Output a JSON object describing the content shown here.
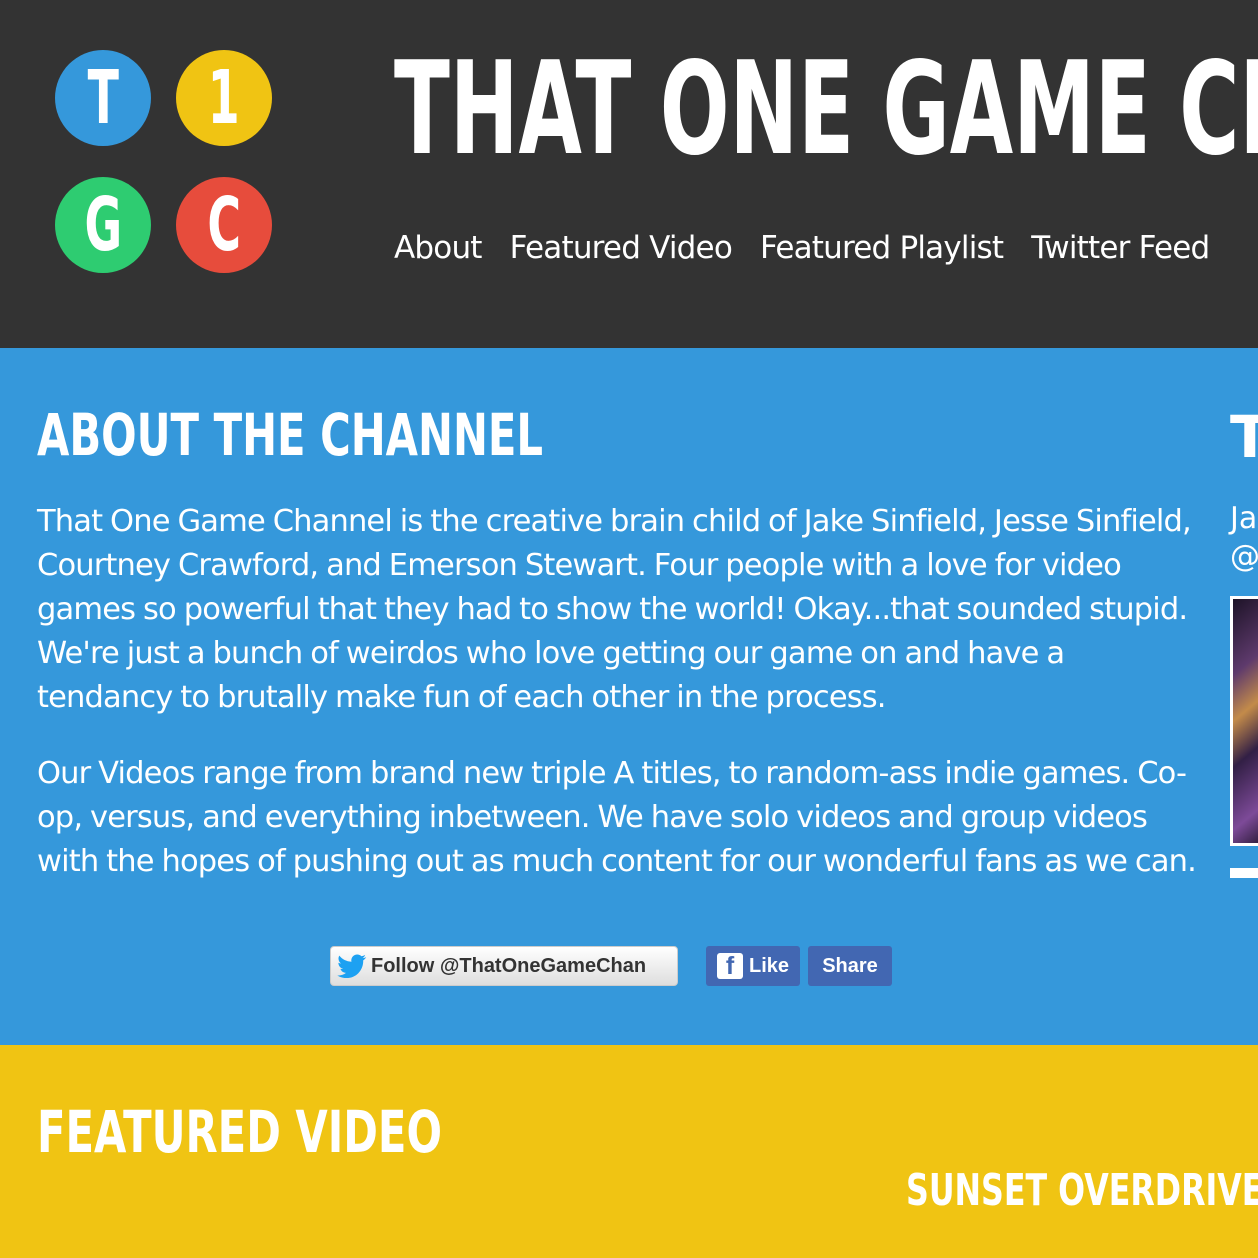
{
  "colors": {
    "header_bg": "#333333",
    "about_bg": "#3598db",
    "featured_bg": "#f0c413",
    "logo_blue": "#3598db",
    "logo_yellow": "#f0c413",
    "logo_green": "#2ecc71",
    "logo_red": "#e74c3c",
    "facebook_blue": "#4267b2"
  },
  "header": {
    "logo": {
      "letters": [
        {
          "char": "T",
          "color": "#3598db"
        },
        {
          "char": "1",
          "color": "#f0c413"
        },
        {
          "char": "G",
          "color": "#2ecc71"
        },
        {
          "char": "C",
          "color": "#e74c3c"
        }
      ]
    },
    "title": "THAT ONE GAME CHAN",
    "nav": [
      "About",
      "Featured Video",
      "Featured Playlist",
      "Twitter Feed"
    ]
  },
  "about": {
    "heading": "ABOUT THE CHANNEL",
    "paragraphs": [
      "That One Game Channel is the creative brain child of Jake Sinfield, Jesse Sinfield, Courtney Crawford, and Emerson Stewart. Four people with a love for video games so powerful that they had to show the world! Okay...that sounded stupid. We're just a bunch of weirdos who love getting our game on and have a tendancy to brutally make fun of each other in the process.",
      "Our Videos range from brand new triple A titles, to random-ass indie games. Co-op, versus, and everything inbetween. We have solo videos and group videos with the hopes of pushing out as much content for our wonderful fans as we can."
    ],
    "social": {
      "twitter_icon": "twitter-bird-icon",
      "twitter_label": "Follow @ThatOneGameChan",
      "facebook_icon": "facebook-f-icon",
      "like_label": "Like",
      "share_label": "Share"
    },
    "side_panel": {
      "heading": "TI",
      "line1": "Jak",
      "line2": "@J"
    }
  },
  "featured": {
    "heading": "FEATURED VIDEO",
    "video_title": "SUNSET OVERDRIVE - FIR"
  }
}
